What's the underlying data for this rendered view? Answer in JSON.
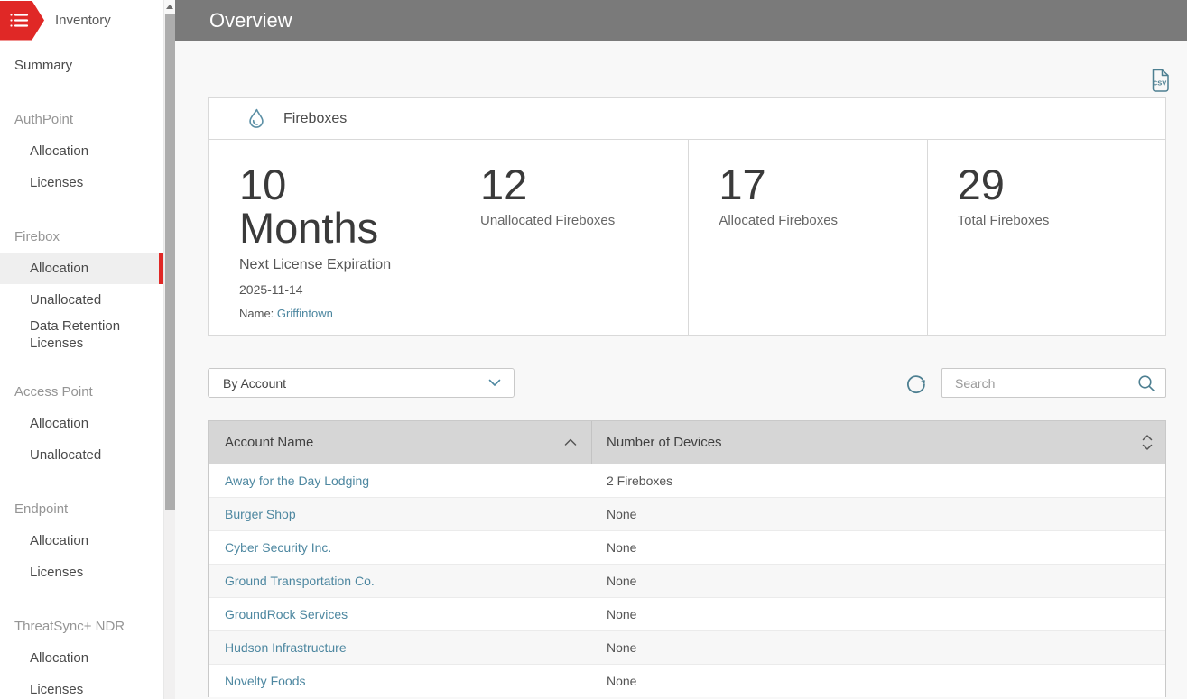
{
  "colors": {
    "accent_red": "#e02826",
    "link_teal": "#4d87a0",
    "icon_teal": "#4d7f91",
    "header_gray": "#7a7a7a",
    "table_header_bg": "#d6d6d6"
  },
  "sidebar": {
    "title": "Inventory",
    "items": [
      {
        "type": "item",
        "label": "Summary"
      },
      {
        "type": "section",
        "label": "AuthPoint"
      },
      {
        "type": "sub",
        "label": "Allocation"
      },
      {
        "type": "sub",
        "label": "Licenses"
      },
      {
        "type": "section",
        "label": "Firebox"
      },
      {
        "type": "sub",
        "label": "Allocation",
        "selected": true
      },
      {
        "type": "sub",
        "label": "Unallocated"
      },
      {
        "type": "sub",
        "label": "Data Retention Licenses"
      },
      {
        "type": "section",
        "label": "Access Point"
      },
      {
        "type": "sub",
        "label": "Allocation"
      },
      {
        "type": "sub",
        "label": "Unallocated"
      },
      {
        "type": "section",
        "label": "Endpoint"
      },
      {
        "type": "sub",
        "label": "Allocation"
      },
      {
        "type": "sub",
        "label": "Licenses"
      },
      {
        "type": "section",
        "label": "ThreatSync+ NDR"
      },
      {
        "type": "sub",
        "label": "Allocation"
      },
      {
        "type": "sub",
        "label": "Licenses"
      }
    ]
  },
  "header": {
    "title": "Overview"
  },
  "icons": {
    "csv_export": "csv-file-icon",
    "card": "firebox-flame-icon",
    "refresh": "refresh-icon",
    "search": "search-icon",
    "sort_asc": "sort-ascending-icon",
    "sort_both": "sort-both-icon",
    "menu": "list-menu-icon"
  },
  "card": {
    "title": "Fireboxes",
    "stats": [
      {
        "value": "10",
        "unit": "Months",
        "label": "Next License Expiration",
        "date": "2025-11-14",
        "name_label": "Name:",
        "name_link": "Griffintown"
      },
      {
        "value": "12",
        "label": "Unallocated Fireboxes"
      },
      {
        "value": "17",
        "label": "Allocated Fireboxes"
      },
      {
        "value": "29",
        "label": "Total Fireboxes"
      }
    ]
  },
  "controls": {
    "filter_value": "By Account",
    "search_placeholder": "Search"
  },
  "table": {
    "columns": [
      {
        "label": "Account Name",
        "sort": "asc"
      },
      {
        "label": "Number of Devices",
        "sort": "none"
      }
    ],
    "rows": [
      {
        "account": "Away for the Day Lodging",
        "devices": "2 Fireboxes"
      },
      {
        "account": "Burger Shop",
        "devices": "None"
      },
      {
        "account": "Cyber Security Inc.",
        "devices": "None"
      },
      {
        "account": "Ground Transportation Co.",
        "devices": "None"
      },
      {
        "account": "GroundRock Services",
        "devices": "None"
      },
      {
        "account": "Hudson Infrastructure",
        "devices": "None"
      },
      {
        "account": "Novelty Foods",
        "devices": "None"
      }
    ]
  }
}
